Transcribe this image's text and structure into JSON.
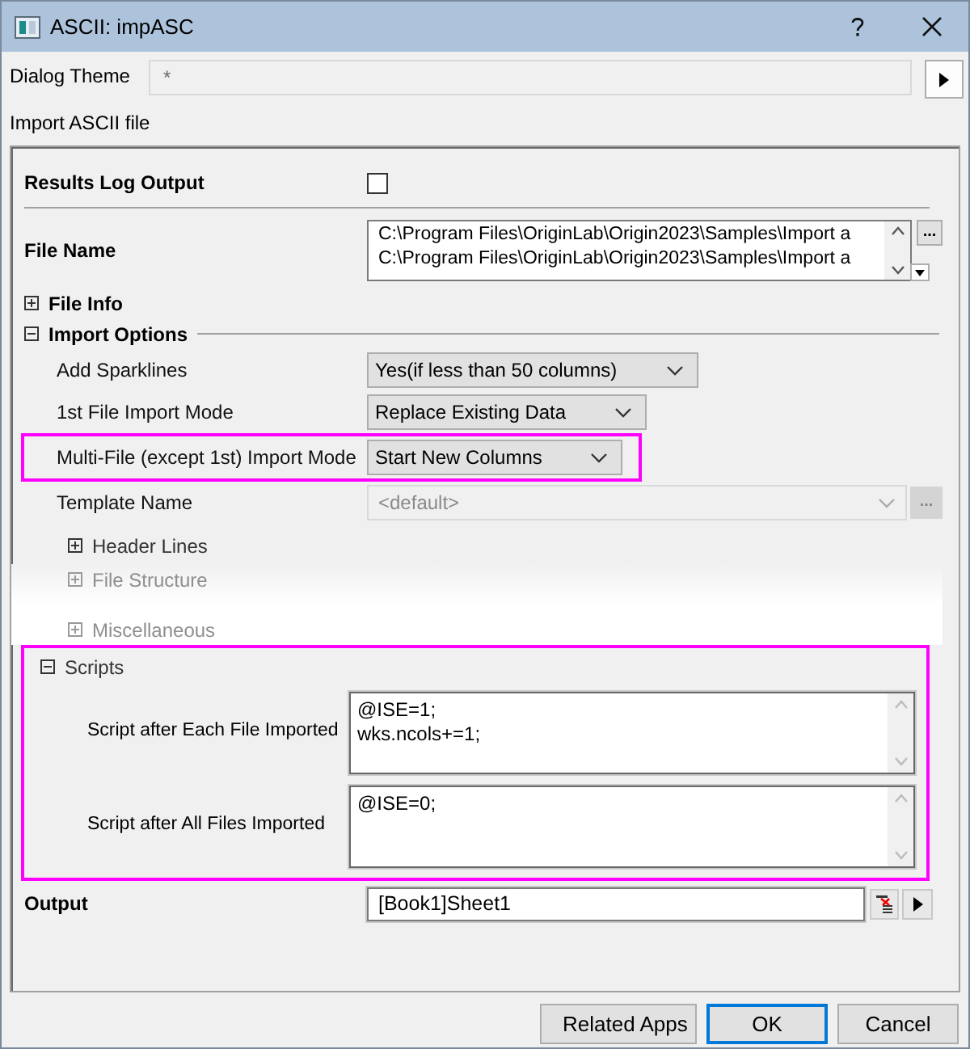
{
  "window": {
    "title": "ASCII: impASC"
  },
  "dialog_theme": {
    "label": "Dialog Theme",
    "value": "*"
  },
  "description": "Import ASCII file",
  "results_log_output": {
    "label": "Results Log Output",
    "checked": false
  },
  "file_name": {
    "label": "File Name",
    "browse_button": "...",
    "lines": [
      "C:\\Program Files\\OriginLab\\Origin2023\\Samples\\Import a",
      "C:\\Program Files\\OriginLab\\Origin2023\\Samples\\Import a"
    ]
  },
  "file_info": {
    "label": "File Info",
    "expanded": false
  },
  "import_options": {
    "label": "Import Options",
    "expanded": true,
    "fields": [
      {
        "kind": "dropdown",
        "label": "Add Sparklines",
        "value": "Yes(if less than 50 columns)",
        "highlighted": false,
        "disabled": false
      },
      {
        "kind": "dropdown",
        "label": "1st File Import Mode",
        "value": "Replace Existing Data",
        "highlighted": false,
        "disabled": false
      },
      {
        "kind": "dropdown",
        "label": "Multi-File (except 1st) Import Mode",
        "value": "Start New Columns",
        "highlighted": true,
        "disabled": false
      },
      {
        "kind": "combo",
        "label": "Template Name",
        "value": "<default>",
        "browse_button": "...",
        "highlighted": false,
        "disabled": true
      }
    ],
    "subgroups": [
      {
        "label": "Header Lines",
        "expanded": false,
        "faded": false
      },
      {
        "label": "File Structure",
        "expanded": false,
        "faded": true
      },
      {
        "label": "Miscellaneous",
        "expanded": false,
        "faded": true
      }
    ],
    "scripts": {
      "label": "Scripts",
      "expanded": true,
      "highlighted": true,
      "fields": [
        {
          "label": "Script after Each File Imported",
          "lines": [
            "@ISE=1;",
            "wks.ncols+=1;"
          ]
        },
        {
          "label": "Script after All Files Imported",
          "lines": [
            "@ISE=0;"
          ]
        }
      ]
    }
  },
  "output": {
    "label": "Output",
    "value": "[Book1]Sheet1"
  },
  "buttons": [
    {
      "label": "Related Apps",
      "default": false
    },
    {
      "label": "OK",
      "default": true
    },
    {
      "label": "Cancel",
      "default": false
    }
  ]
}
